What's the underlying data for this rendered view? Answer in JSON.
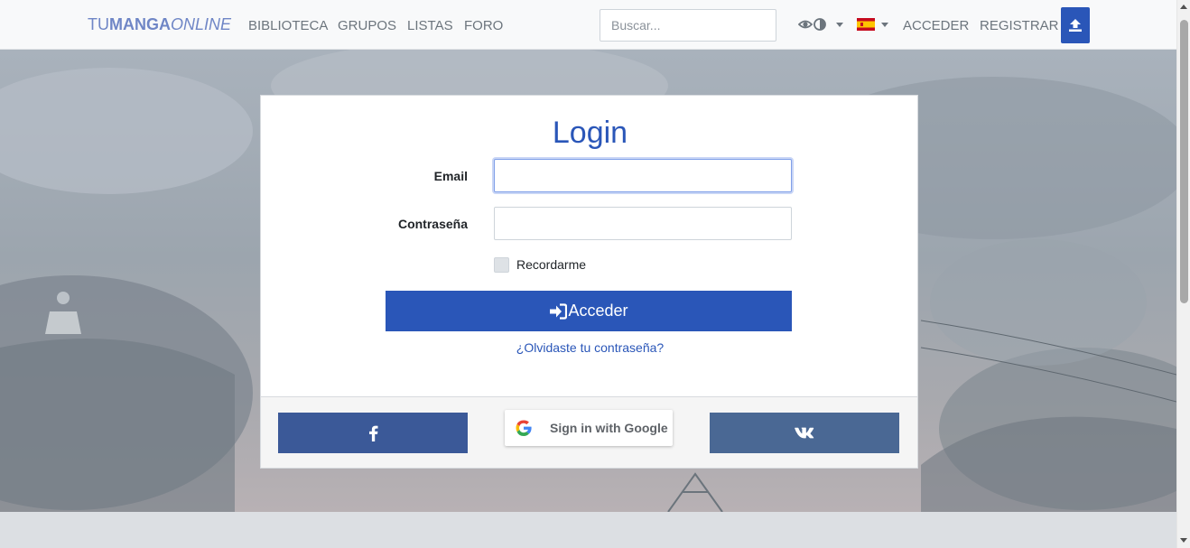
{
  "navbar": {
    "brand": {
      "part1": "TU",
      "part2": "MANGA",
      "part3": "ONLINE"
    },
    "links": [
      "BIBLIOTECA",
      "GRUPOS",
      "LISTAS",
      "FORO"
    ],
    "search_placeholder": "Buscar...",
    "view_toggle_icon": "eye-icon",
    "language_flag": "spain-flag-icon",
    "login_link": "ACCEDER",
    "register_link": "REGISTRAR",
    "upload_icon": "upload-icon"
  },
  "login": {
    "title": "Login",
    "email_label": "Email",
    "email_value": "",
    "password_label": "Contraseña",
    "password_value": "",
    "remember_label": "Recordarme",
    "submit_label": "Acceder",
    "submit_icon": "sign-in-icon",
    "forgot_label": "¿Olvidaste tu contraseña?"
  },
  "social": {
    "facebook_icon": "facebook-icon",
    "google_label": "Sign in with Google",
    "google_icon": "google-icon",
    "vk_icon": "vk-icon"
  },
  "colors": {
    "primary": "#2a56b8",
    "facebook": "#3b5998",
    "vk": "#4a6894",
    "brand": "#6f86c6"
  }
}
